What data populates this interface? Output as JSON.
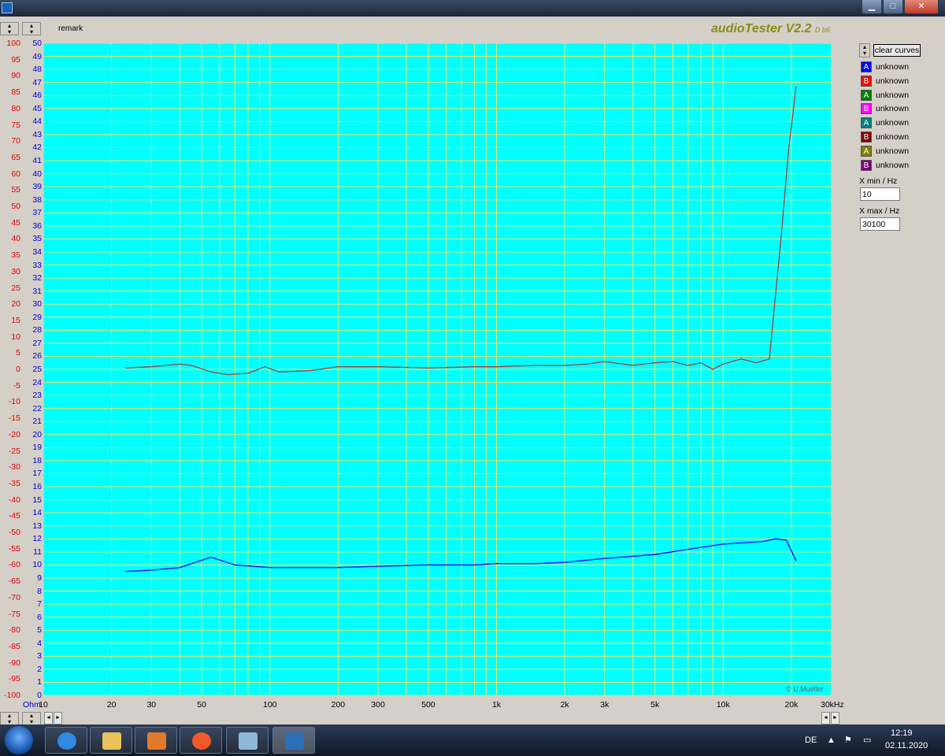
{
  "window": {
    "title_icon": "app-icon",
    "buttons": [
      "minimize-icon",
      "maximize-icon",
      "close-icon"
    ]
  },
  "toolbar": {
    "remark": "remark",
    "brand": "audioTester  V2.2",
    "brand_version": "D b6"
  },
  "y_left": [
    "100",
    "95",
    "90",
    "85",
    "80",
    "75",
    "70",
    "65",
    "60",
    "55",
    "50",
    "45",
    "40",
    "35",
    "30",
    "25",
    "20",
    "15",
    "10",
    "5",
    "0",
    "-5",
    "-10",
    "-15",
    "-20",
    "-25",
    "-30",
    "-35",
    "-40",
    "-45",
    "-50",
    "-55",
    "-60",
    "-65",
    "-70",
    "-75",
    "-80",
    "-85",
    "-90",
    "-95",
    "-100"
  ],
  "y_right": [
    "50",
    "49",
    "48",
    "47",
    "46",
    "45",
    "44",
    "43",
    "42",
    "41",
    "40",
    "39",
    "38",
    "37",
    "36",
    "35",
    "34",
    "33",
    "32",
    "31",
    "30",
    "29",
    "28",
    "27",
    "26",
    "25",
    "24",
    "23",
    "22",
    "21",
    "20",
    "19",
    "18",
    "17",
    "16",
    "15",
    "14",
    "13",
    "12",
    "11",
    "10",
    "9",
    "8",
    "7",
    "6",
    "5",
    "4",
    "3",
    "2",
    "1",
    "0"
  ],
  "x_ticks": [
    "10",
    "20",
    "30",
    "50",
    "100",
    "200",
    "300",
    "500",
    "1k",
    "2k",
    "3k",
    "5k",
    "10k",
    "20k",
    "30kHz"
  ],
  "y_unit": "Ohm",
  "copyright": "© U.Mueller",
  "sidebar": {
    "clear_label": "clear curves",
    "legend": [
      {
        "letter": "A",
        "label": "unknown",
        "color": "#0000ff"
      },
      {
        "letter": "B",
        "label": "unknown",
        "color": "#ff0000"
      },
      {
        "letter": "A",
        "label": "unknown",
        "color": "#008000"
      },
      {
        "letter": "B",
        "label": "unknown",
        "color": "#ff00ff"
      },
      {
        "letter": "A",
        "label": "unknown",
        "color": "#008080"
      },
      {
        "letter": "B",
        "label": "unknown",
        "color": "#800000"
      },
      {
        "letter": "A",
        "label": "unknown",
        "color": "#808000"
      },
      {
        "letter": "B",
        "label": "unknown",
        "color": "#800080"
      }
    ],
    "xmin_label": "X min / Hz",
    "xmin_value": "10",
    "xmax_label": "X max / Hz",
    "xmax_value": "30100"
  },
  "taskbar": {
    "lang": "DE",
    "time": "12:19",
    "date": "02.11.2020"
  },
  "chart_data": {
    "type": "line",
    "x_scale": "log",
    "xlim": [
      10,
      30100
    ],
    "ylim_left": [
      -100,
      100
    ],
    "ylim_right": [
      0,
      50
    ],
    "background": "#00ffff",
    "grid_color": "#e8e866",
    "series": [
      {
        "color": "#a04040",
        "axis": "right",
        "x": [
          23,
          30,
          40,
          45,
          55,
          65,
          80,
          95,
          110,
          150,
          200,
          300,
          500,
          800,
          1000,
          1500,
          2000,
          2500,
          3000,
          4000,
          5000,
          6000,
          7000,
          8000,
          9000,
          10000,
          12000,
          14000,
          16000,
          18000,
          19500,
          21000
        ],
        "y": [
          25.1,
          25.2,
          25.4,
          25.3,
          24.8,
          24.6,
          24.7,
          25.2,
          24.8,
          24.9,
          25.2,
          25.2,
          25.1,
          25.2,
          25.2,
          25.3,
          25.3,
          25.4,
          25.6,
          25.3,
          25.5,
          25.6,
          25.3,
          25.5,
          25.0,
          25.4,
          25.8,
          25.5,
          25.8,
          35.0,
          42.0,
          46.7
        ]
      },
      {
        "color": "#0000ff",
        "axis": "right",
        "x": [
          23,
          30,
          40,
          55,
          70,
          100,
          200,
          300,
          500,
          800,
          1000,
          1500,
          2000,
          3000,
          5000,
          7000,
          10000,
          15000,
          17000,
          19000,
          21000
        ],
        "y": [
          9.5,
          9.6,
          9.8,
          10.6,
          10.0,
          9.8,
          9.8,
          9.9,
          10.0,
          10.0,
          10.1,
          10.1,
          10.2,
          10.5,
          10.8,
          11.2,
          11.6,
          11.8,
          12.0,
          11.9,
          10.3
        ]
      }
    ]
  }
}
